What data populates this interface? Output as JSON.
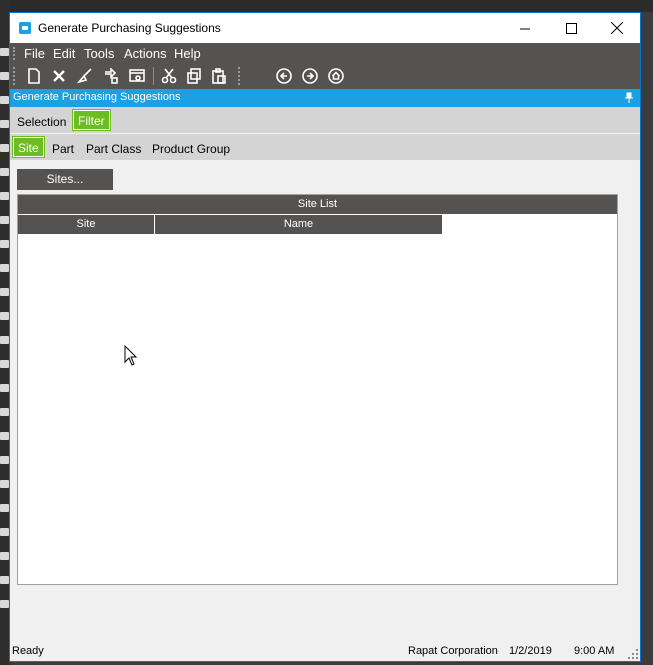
{
  "window": {
    "title": "Generate Purchasing Suggestions"
  },
  "menu": {
    "items": [
      "File",
      "Edit",
      "Tools",
      "Actions",
      "Help"
    ]
  },
  "toolbar": {
    "buttons": [
      "new-icon",
      "delete-icon",
      "clear-icon",
      "refresh-icon",
      "print-preview-icon",
      "cut-icon",
      "copy-icon",
      "paste-icon",
      "back-icon",
      "forward-icon",
      "home-icon"
    ]
  },
  "form": {
    "title": "Generate Purchasing Suggestions"
  },
  "tabs_main": {
    "items": [
      "Selection",
      "Filter"
    ],
    "active": "Filter"
  },
  "tabs_filter": {
    "items": [
      "Site",
      "Part",
      "Part Class",
      "Product Group"
    ],
    "active": "Site"
  },
  "sites_button": {
    "label": "Sites..."
  },
  "grid": {
    "caption": "Site List",
    "columns": [
      "Site",
      "Name"
    ],
    "rows": []
  },
  "status": {
    "state": "Ready",
    "company": "Rapat Corporation",
    "date": "1/2/2019",
    "time": "9:00 AM"
  },
  "colors": {
    "accent_blue": "#1ba1e2",
    "active_tab_green": "#6bbd23",
    "dark_bar": "#555352"
  }
}
